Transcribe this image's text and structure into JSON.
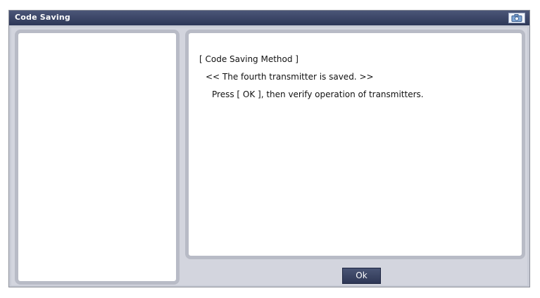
{
  "window": {
    "title": "Code Saving",
    "camera_icon": "camera-icon"
  },
  "message": {
    "method_title": "[ Code Saving Method ]",
    "saved_line": "<< The fourth transmitter is saved. >>",
    "instruction": "Press [ OK ], then verify operation of transmitters."
  },
  "buttons": {
    "ok_label": "Ok"
  },
  "colors": {
    "titlebar": "#2d3757",
    "window_bg": "#c9ccd6",
    "panel_border": "#b8bbc6",
    "button_bg": "#2e3755"
  }
}
